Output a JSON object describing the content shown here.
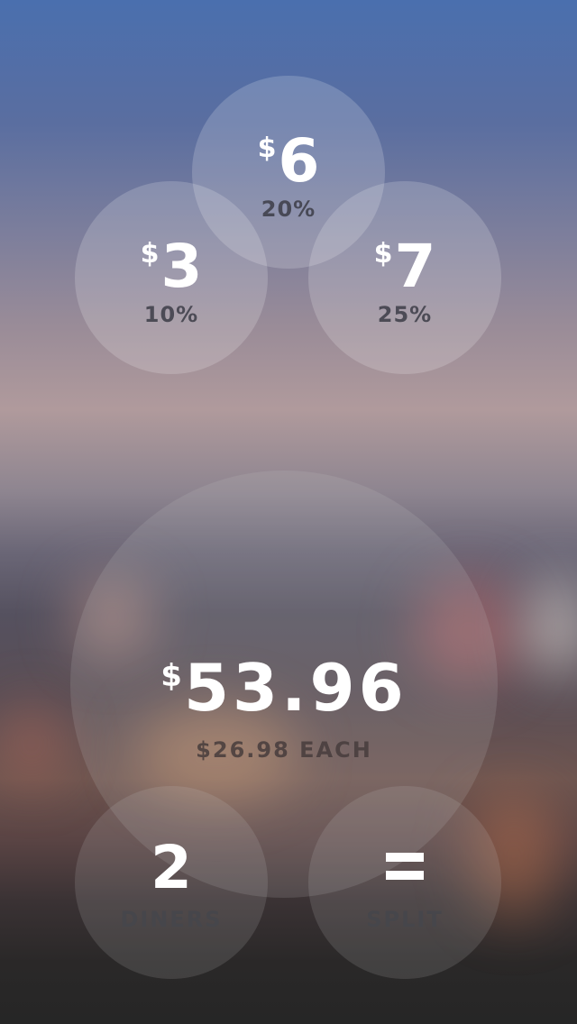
{
  "tip_options": [
    {
      "amount": "6",
      "percent": "20%"
    },
    {
      "amount": "3",
      "percent": "10%"
    },
    {
      "amount": "7",
      "percent": "25%"
    }
  ],
  "currency_symbol": "$",
  "total": {
    "amount": "53.96",
    "per_person": "$26.98 EACH"
  },
  "diners": {
    "count": "2",
    "label": "DINERS"
  },
  "split": {
    "icon": "equals-icon",
    "label": "SPLIT"
  }
}
